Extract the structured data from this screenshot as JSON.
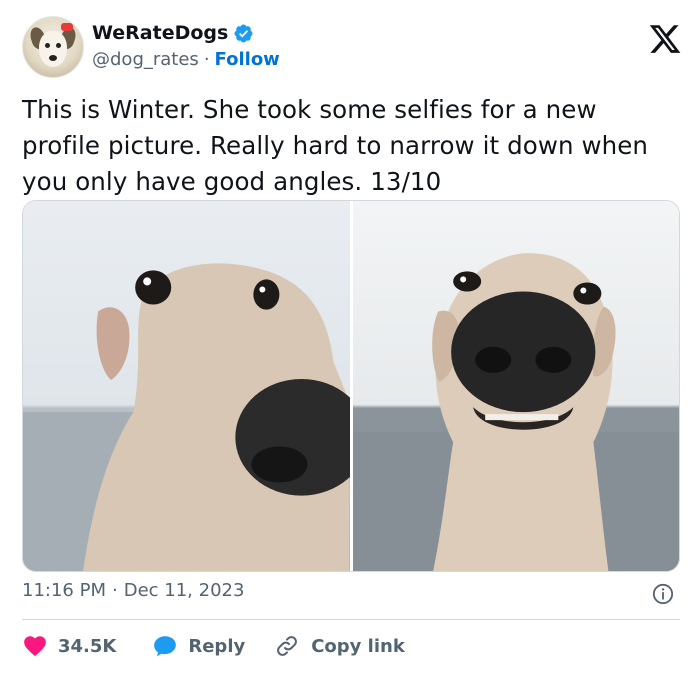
{
  "user": {
    "name": "WeRateDogs",
    "handle": "@dog_rates",
    "separator": "·",
    "follow_label": "Follow"
  },
  "tweet": {
    "text": "This is Winter. She took some selfies for a new profile picture. Really hard to narrow it down when you only have good angles. 13/10",
    "time": "11:16 PM",
    "date": "Dec 11, 2023",
    "meta_separator": "·"
  },
  "actions": {
    "likes_count": "34.5K",
    "reply_label": "Reply",
    "copy_link_label": "Copy link"
  },
  "icons": {
    "verified": "verified-badge-icon",
    "x_logo": "x-logo-icon",
    "info": "info-icon",
    "heart": "heart-icon",
    "reply": "reply-bubble-icon",
    "link": "link-icon"
  },
  "colors": {
    "verified_blue": "#1d9bf0",
    "follow_blue": "#0074d4",
    "heart_red": "#f91880",
    "reply_blue": "#1d9bf0",
    "muted_text": "#536471"
  }
}
